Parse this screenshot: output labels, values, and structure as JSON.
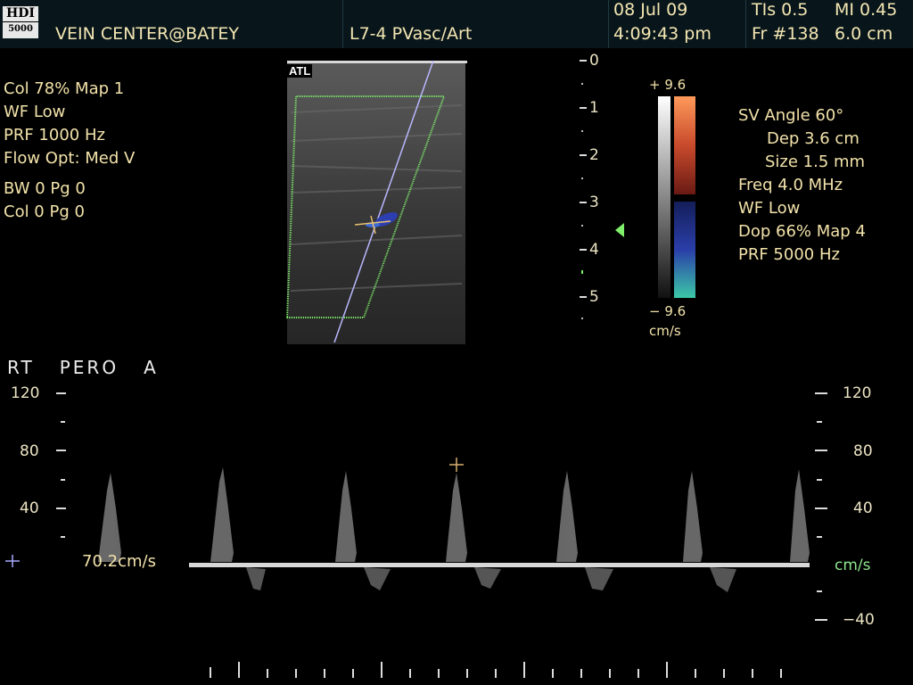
{
  "header": {
    "logo_line1": "HDI",
    "logo_line2": "5000",
    "facility": "VEIN CENTER@BATEY",
    "transducer": "L7-4 PVasc/Art",
    "date": "08 Jul 09",
    "time": "4:09:43 pm",
    "tis": "TIs 0.5",
    "mi": "MI 0.45",
    "frame": "Fr #138",
    "depth": "6.0 cm"
  },
  "left_panel": {
    "col": "Col 78%  Map 1",
    "wf": "WF Low",
    "prf": "PRF 1000  Hz",
    "flow_opt": "Flow Opt: Med V",
    "bw": "BW 0    Pg 0",
    "col2": "Col 0    Pg 0"
  },
  "image_area": {
    "brand": "ATL",
    "depth_ticks": [
      "0",
      "1",
      "2",
      "3",
      "4",
      "5"
    ]
  },
  "color_bar": {
    "top": "+ 9.6",
    "bottom": "− 9.6",
    "unit": "cm/s",
    "colors": [
      "#ff9a5a",
      "#c84a2c",
      "#6a1a14",
      "#141e5a",
      "#2a3ea8",
      "#3cc8a8"
    ]
  },
  "right_panel": {
    "sv_angle": "SV Angle 60°",
    "dep": "Dep 3.6  cm",
    "size": "Size 1.5  mm",
    "freq": "Freq 4.0  MHz",
    "wf": "WF Low",
    "dop": "Dop 66%  Map 4",
    "prf": "PRF 5000  Hz"
  },
  "spectral": {
    "vessel_label": "RT   PERO   A",
    "scale_left": [
      "120",
      "80",
      "40"
    ],
    "scale_right": [
      "120",
      "80",
      "40",
      "−40"
    ],
    "unit": "cm/s",
    "measurement": "70.2cm/s"
  }
}
